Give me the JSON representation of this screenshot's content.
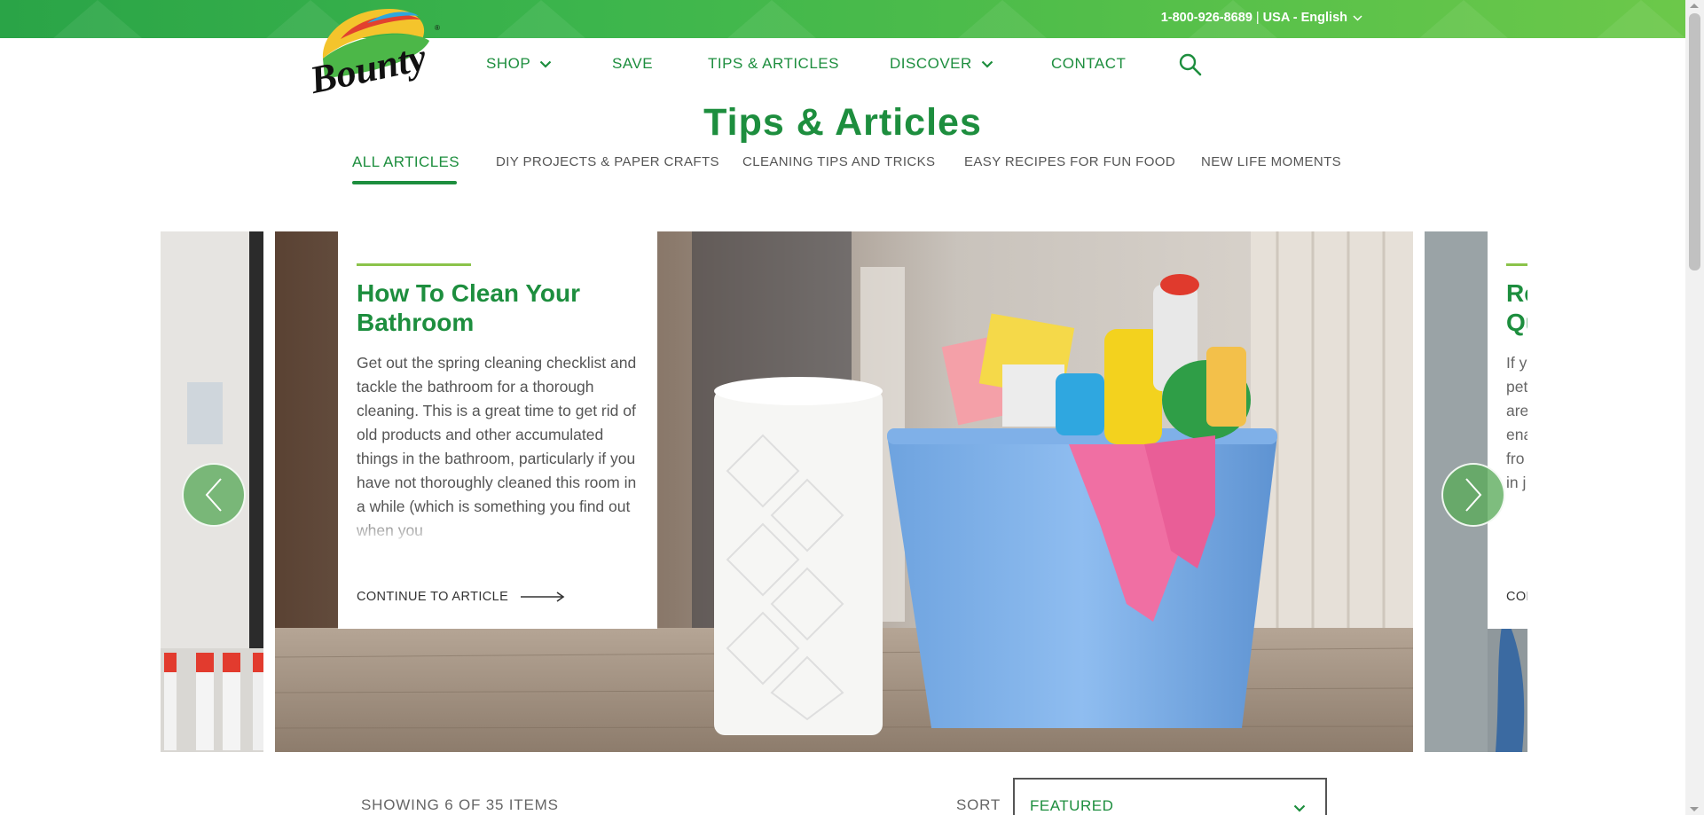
{
  "colors": {
    "brand_green": "#1d8e3e",
    "topbar_green": "#3cb54c",
    "accent_lime": "#8bc34a"
  },
  "topbar": {
    "phone": "1-800-926-8689",
    "separator": "|",
    "region": "USA - English"
  },
  "logo": {
    "text": "Bounty"
  },
  "nav": {
    "items": [
      {
        "label": "SHOP",
        "has_dropdown": true
      },
      {
        "label": "SAVE",
        "has_dropdown": false
      },
      {
        "label": "TIPS & ARTICLES",
        "has_dropdown": false
      },
      {
        "label": "DISCOVER",
        "has_dropdown": true
      },
      {
        "label": "CONTACT",
        "has_dropdown": false
      }
    ],
    "search_icon": "search-icon"
  },
  "page": {
    "title": "Tips & Articles"
  },
  "tabs": [
    {
      "label": "ALL ARTICLES",
      "active": true
    },
    {
      "label": "DIY PROJECTS & PAPER CRAFTS",
      "active": false
    },
    {
      "label": "CLEANING TIPS AND TRICKS",
      "active": false
    },
    {
      "label": "EASY RECIPES FOR FUN FOOD",
      "active": false
    },
    {
      "label": "NEW LIFE MOMENTS",
      "active": false
    }
  ],
  "carousel": {
    "main": {
      "title": "How To Clean Your Bathroom",
      "excerpt": "Get out the spring cleaning checklist and tackle the bathroom for a thorough cleaning. This is a great time to get rid of old products and other accumulated things in the bathroom, particularly if you have not thoroughly cleaned this room in a while (which is something you find out when you",
      "cta": "CONTINUE TO ARTICLE"
    },
    "next_peek": {
      "title_line1": "Re",
      "title_line2": "Qu",
      "text_lines": [
        "If y",
        "pet",
        "are",
        "ena",
        "fro",
        "in j"
      ],
      "cta": "CON"
    },
    "prev_icon": "chevron-left-icon",
    "next_icon": "chevron-right-icon"
  },
  "listing": {
    "showing": "SHOWING 6 OF 35 ITEMS",
    "sort_label": "SORT",
    "sort_value": "FEATURED"
  }
}
